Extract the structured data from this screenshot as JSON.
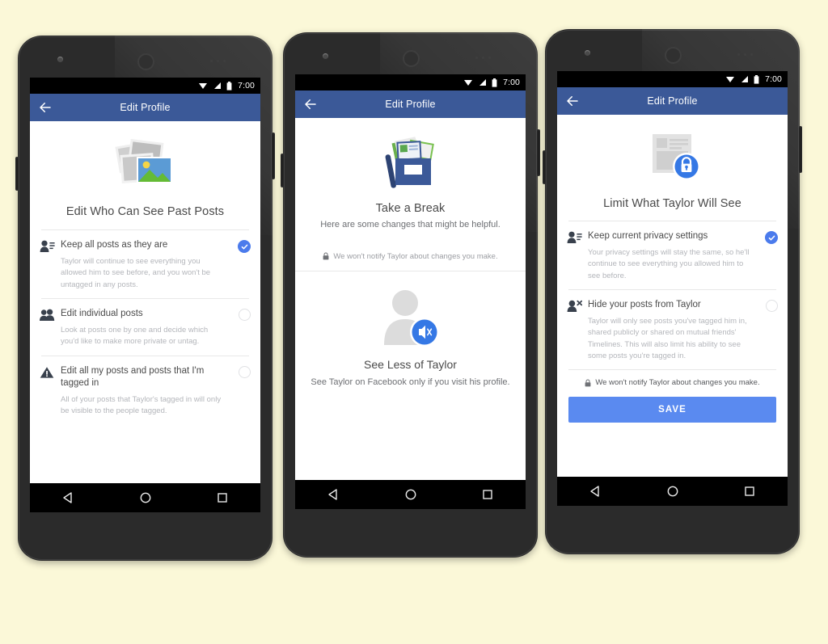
{
  "background_color": "#fbf8d8",
  "theme": {
    "appbar_blue": "#3b5998",
    "accent_blue": "#4b7bec",
    "save_blue": "#5a8af0",
    "title_gray": "#4a4a4a",
    "desc_gray": "#b4b6bb"
  },
  "common": {
    "status_time": "7:00",
    "appbar_title": "Edit Profile",
    "back_icon": "arrow-left-icon",
    "nav_back_icon": "triangle-back-icon",
    "nav_home_icon": "circle-home-icon",
    "nav_recents_icon": "square-recents-icon",
    "status_icons": [
      "wifi-icon",
      "signal-icon",
      "battery-icon"
    ]
  },
  "phones": [
    {
      "id": "phone-1",
      "hero": {
        "art": "photo-stack-icon",
        "title": "Edit Who Can See Past Posts"
      },
      "options": [
        {
          "icon": "person-list-icon",
          "title": "Keep all posts as they are",
          "desc": "Taylor will continue to see everything you allowed him to see before, and you won't be untagged in any posts.",
          "selected": true
        },
        {
          "icon": "two-people-icon",
          "title": "Edit individual posts",
          "desc": "Look at posts one by one and decide which you'd like to make more private or untag.",
          "selected": false
        },
        {
          "icon": "warning-triangle-icon",
          "title": "Edit all my posts and posts that I'm tagged in",
          "desc": "All of your posts that Taylor's tagged in will only be visible to the people tagged.",
          "selected": false
        }
      ]
    },
    {
      "id": "phone-2",
      "hero": {
        "art": "photo-box-icon",
        "title": "Take a Break",
        "subtitle": "Here are some changes that might be helpful."
      },
      "notice": {
        "icon": "lock-icon",
        "text": "We won't notify Taylor about changes you make."
      },
      "center_block": {
        "art": "person-mute-icon",
        "title": "See Less of Taylor",
        "subtitle": "See Taylor on Facebook only if you visit his profile."
      }
    },
    {
      "id": "phone-3",
      "hero": {
        "art": "post-lock-icon",
        "title": "Limit What Taylor Will See"
      },
      "options": [
        {
          "icon": "person-list-icon",
          "title": "Keep current privacy settings",
          "desc": "Your privacy settings will stay the same, so he'll continue to see everything you allowed him to see before.",
          "selected": true
        },
        {
          "icon": "person-block-icon",
          "title": "Hide your posts from Taylor",
          "desc": "Taylor will only see posts you've tagged him in, shared publicly or shared on mutual friends' Timelines. This will also limit his ability to see some posts you're tagged in.",
          "selected": false
        }
      ],
      "notice": {
        "icon": "lock-icon",
        "text": "We won't notify Taylor about changes you make."
      },
      "save_label": "SAVE"
    }
  ]
}
